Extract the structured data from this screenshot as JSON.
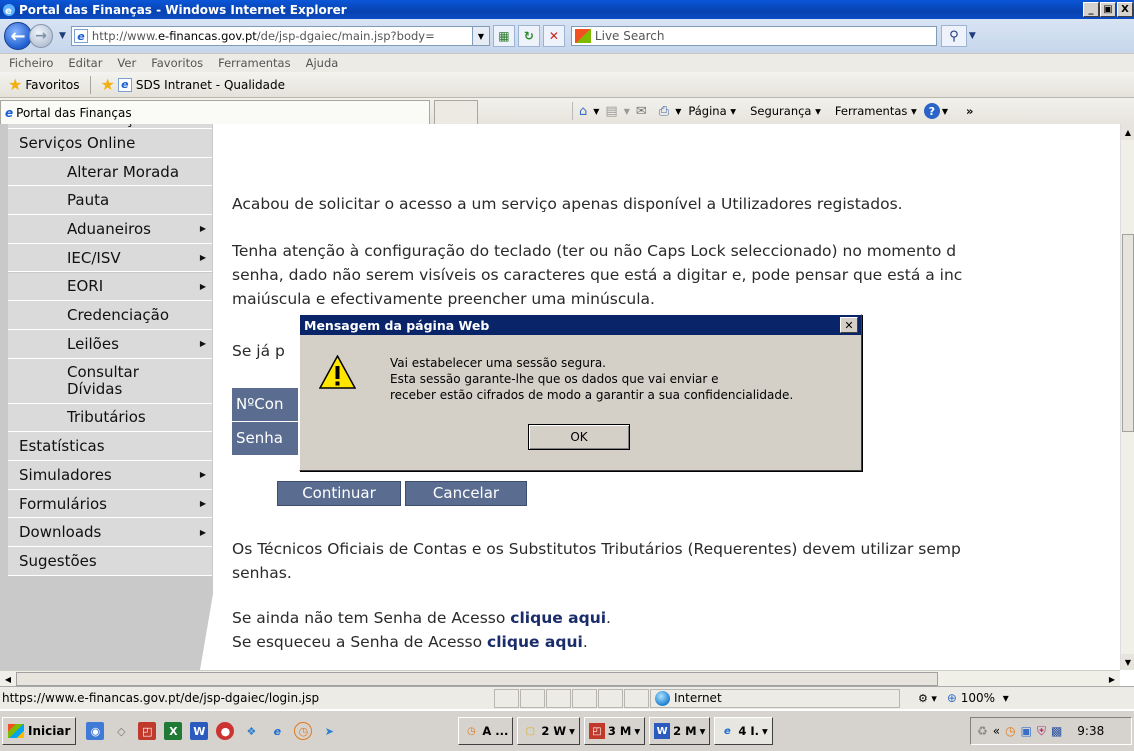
{
  "window": {
    "title": "Portal das Finanças - Windows Internet Explorer",
    "controls": [
      "_",
      "á",
      "X"
    ]
  },
  "address": {
    "url_prefix": "http://www.",
    "url_domain": "e-financas.gov.pt",
    "url_suffix": "/de/jsp-dgaiec/main.jsp?body=",
    "search_placeholder": "Live Search"
  },
  "menu": [
    "Ficheiro",
    "Editar",
    "Ver",
    "Favoritos",
    "Ferramentas",
    "Ajuda"
  ],
  "favorites": {
    "label": "Favoritos",
    "link": "SDS Intranet - Qualidade"
  },
  "tab": {
    "label": "Portal das Finanças"
  },
  "commands": {
    "page": "Página",
    "security": "Segurança",
    "tools": "Ferramentas"
  },
  "sidebar": {
    "partial_top": "Informação",
    "items": [
      {
        "label": "Serviços Online",
        "level": "top",
        "arrow": false
      },
      {
        "label": "Alterar Morada",
        "level": "sub",
        "arrow": false
      },
      {
        "label": "Pauta",
        "level": "sub",
        "arrow": false
      },
      {
        "label": "Aduaneiros",
        "level": "sub",
        "arrow": true
      },
      {
        "label": "IEC/ISV",
        "level": "sub",
        "arrow": true
      },
      {
        "label": "EORI",
        "level": "sub",
        "arrow": true
      },
      {
        "label": "Credenciação",
        "level": "sub",
        "arrow": false
      },
      {
        "label": "Leilões",
        "level": "sub",
        "arrow": true
      },
      {
        "label": "Consultar Dívidas",
        "level": "sub",
        "arrow": false
      },
      {
        "label": "Tributários",
        "level": "sub",
        "arrow": false
      },
      {
        "label": "Estatísticas",
        "level": "top",
        "arrow": false
      },
      {
        "label": "Simuladores",
        "level": "top",
        "arrow": true
      },
      {
        "label": "Formulários",
        "level": "top",
        "arrow": true
      },
      {
        "label": "Downloads",
        "level": "top",
        "arrow": true
      },
      {
        "label": "Sugestões",
        "level": "top",
        "arrow": false
      }
    ]
  },
  "main": {
    "intro": "Acabou de solicitar o acesso a um serviço apenas disponível a Utilizadores registados.",
    "keyboard_line1": "Tenha atenção à configuração do teclado (ter ou não Caps Lock seleccionado) no momento d",
    "keyboard_line2": "senha, dado não serem visíveis os caracteres que está a digitar e, pode pensar que está a inc",
    "keyboard_line3": "maiúscula e efectivamente preencher uma minúscula.",
    "already_prefix": "Se já p",
    "field_nc": "NºCon",
    "field_senha": "Senha",
    "btn_continue": "Continuar",
    "btn_cancel": "Cancelar",
    "toc_line1": "Os Técnicos Oficiais de Contas e os Substitutos Tributários (Requerentes) devem utilizar semp",
    "toc_line2": "senhas.",
    "no_pass_text": "Se ainda não tem Senha de Acesso ",
    "no_pass_link": "clique aqui",
    "forgot_text": "Se esqueceu a Senha de Acesso ",
    "forgot_link": "clique aqui",
    "period": "."
  },
  "dialog": {
    "title": "Mensagem da página Web",
    "line1": "Vai estabelecer uma sessão segura.",
    "line2": "Esta sessão garante-lhe que os dados que vai enviar e",
    "line3": "receber estão cifrados de modo a garantir a sua confidencialidade.",
    "ok": "OK"
  },
  "status": {
    "url": "https://www.e-financas.gov.pt/de/jsp-dgaiec/login.jsp",
    "zone": "Internet",
    "zoom": "100%"
  },
  "taskbar": {
    "start": "Iniciar",
    "buttons": [
      "A ...",
      "2 W",
      "3 M",
      "2 M",
      "4 I."
    ],
    "clock": "9:38"
  },
  "colors": {
    "nav_bg": "#dadada",
    "form_blue": "#5a6d91",
    "link": "#1a2d6a",
    "dialog_title": "#0a246a"
  }
}
